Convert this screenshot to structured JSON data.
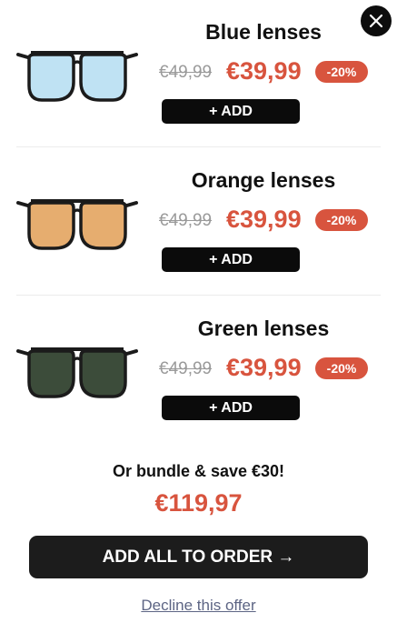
{
  "close": {
    "icon": "close-icon"
  },
  "products": [
    {
      "title": "Blue lenses",
      "old_price": "€49,99",
      "new_price": "€39,99",
      "discount": "-20%",
      "add_label": "+ ADD",
      "lens_color": "#bfe2f3"
    },
    {
      "title": "Orange lenses",
      "old_price": "€49,99",
      "new_price": "€39,99",
      "discount": "-20%",
      "add_label": "+ ADD",
      "lens_color": "#e6ad6f"
    },
    {
      "title": "Green lenses",
      "old_price": "€49,99",
      "new_price": "€39,99",
      "discount": "-20%",
      "add_label": "+ ADD",
      "lens_color": "#3c4c3a"
    }
  ],
  "bundle": {
    "text": "Or bundle & save €30!",
    "price": "€119,97"
  },
  "add_all_label": "ADD ALL TO ORDER →",
  "decline_label": "Decline this offer",
  "colors": {
    "accent": "#d8543e",
    "button": "#0b0b0b",
    "link": "#5d6584"
  }
}
